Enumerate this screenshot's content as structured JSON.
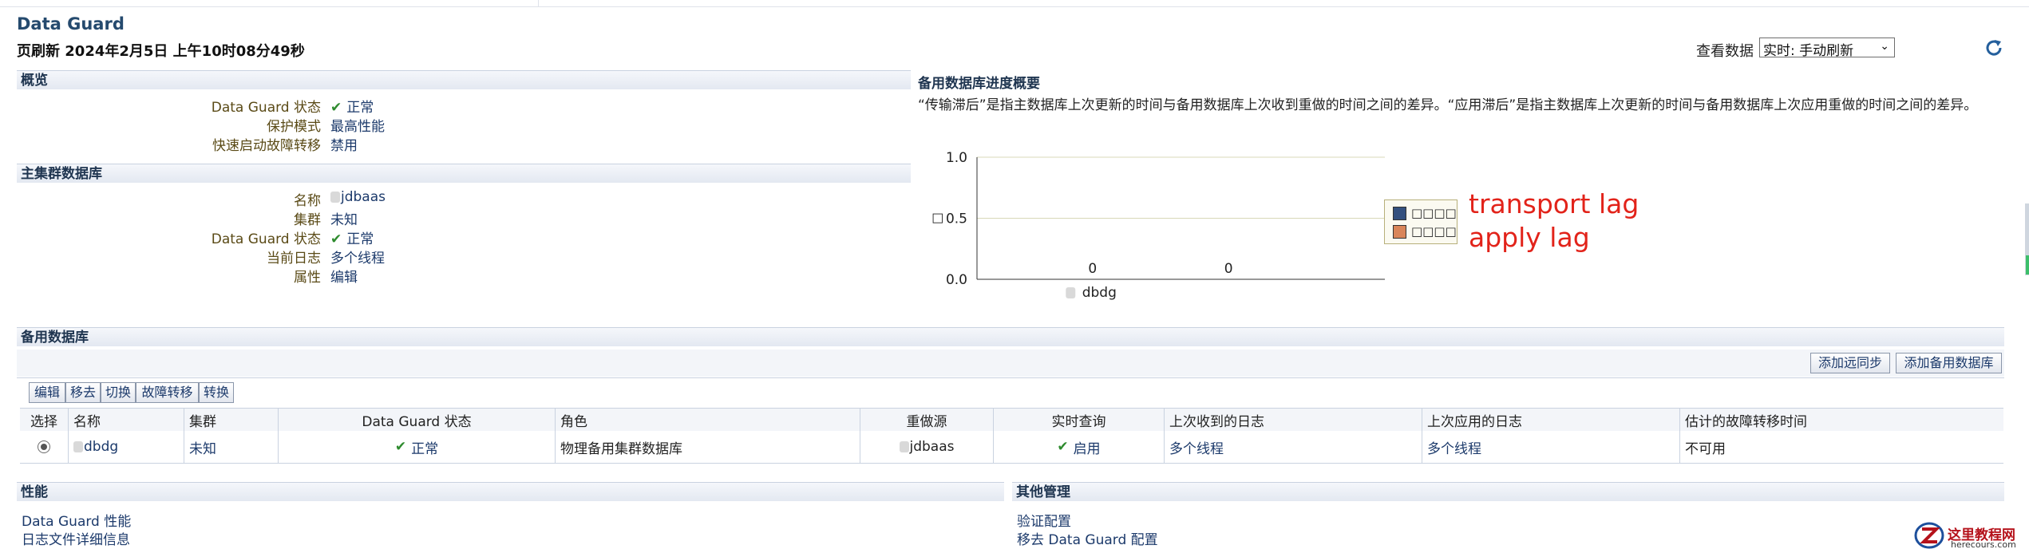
{
  "page": {
    "title": "Data Guard",
    "refresh_text": "页刷新 2024年2月5日 上午10时08分49秒",
    "view_data_label": "查看数据",
    "view_data_value": "实时: 手动刷新"
  },
  "overview": {
    "heading": "概览",
    "rows": [
      {
        "label": "Data Guard 状态",
        "value": "正常"
      },
      {
        "label": "保护模式",
        "value": "最高性能"
      },
      {
        "label": "快速启动故障转移",
        "value": "禁用"
      }
    ]
  },
  "primary": {
    "heading": "主集群数据库",
    "rows": [
      {
        "label": "名称",
        "value": "jdbaas"
      },
      {
        "label": "集群",
        "value": "未知"
      },
      {
        "label": "Data Guard 状态",
        "value": "正常"
      },
      {
        "label": "当前日志",
        "value": "多个线程"
      },
      {
        "label": "属性",
        "value": "编辑"
      }
    ]
  },
  "progress": {
    "heading": "备用数据库进度概要",
    "description": "“传输滞后”是指主数据库上次更新的时间与备用数据库上次收到重做的时间之间的差异。“应用滞后”是指主数据库上次更新的时间与备用数据库上次应用重做的时间之间的差异。",
    "annotation_transport": "transport lag",
    "annotation_apply": "apply lag"
  },
  "chart_data": {
    "type": "bar",
    "categories": [
      "dbdg"
    ],
    "series": [
      {
        "name": "□□□□",
        "values": [
          0
        ],
        "color": "#34507e"
      },
      {
        "name": "□□□□",
        "values": [
          0
        ],
        "color": "#d9855a"
      }
    ],
    "ylabel": "□",
    "ylim": [
      0,
      1.0
    ],
    "yticks": [
      "1.0",
      "0.5",
      "0.0"
    ],
    "data_labels": [
      "0",
      "0"
    ],
    "legend": "right"
  },
  "standby": {
    "heading": "备用数据库",
    "add_far_sync": "添加远同步",
    "add_standby": "添加备用数据库",
    "actions": [
      "编辑",
      "移去",
      "切换",
      "故障转移",
      "转换"
    ],
    "columns": [
      "选择",
      "名称",
      "集群",
      "Data Guard 状态",
      "角色",
      "重做源",
      "实时查询",
      "上次收到的日志",
      "上次应用的日志",
      "估计的故障转移时间"
    ],
    "row": {
      "name": "dbdg",
      "cluster": "未知",
      "status": "正常",
      "role": "物理备用集群数据库",
      "redo_source": "jdbaas",
      "realtime_query": "启用",
      "last_received": "多个线程",
      "last_applied": "多个线程",
      "failover_time": "不可用"
    }
  },
  "performance": {
    "heading": "性能",
    "links": [
      "Data Guard 性能",
      "日志文件详细信息"
    ]
  },
  "other": {
    "heading": "其他管理",
    "links": [
      "验证配置",
      "移去 Data Guard 配置"
    ]
  },
  "watermark": {
    "text": "这里教程网",
    "sub": "herecours.com"
  },
  "colors": {
    "heading_blue": "#254a6e",
    "link_blue": "#1c3a6b",
    "label_olive": "#5a4a16",
    "ok_green": "#2e8b2e",
    "annotation_red": "#e2231a"
  }
}
